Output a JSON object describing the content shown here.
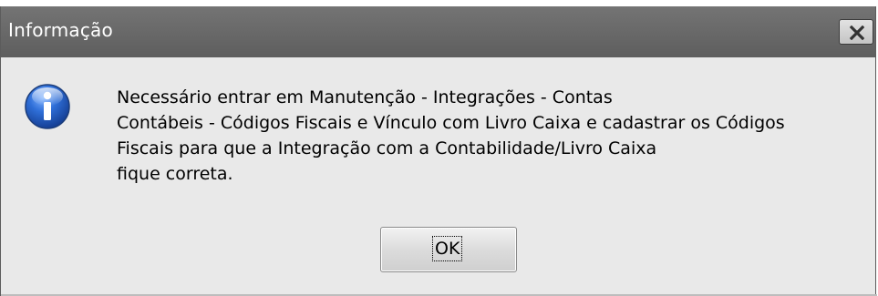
{
  "dialog": {
    "title": "Informação",
    "close_icon": "close-icon",
    "icon": "info-icon",
    "message_lines": [
      "Necessário entrar em Manutenção - Integrações - Contas",
      "Contábeis - Códigos Fiscais e Vínculo com Livro Caixa e cadastrar os Códigos",
      "Fiscais para que a Integração com a Contabilidade/Livro Caixa",
      "fique correta."
    ],
    "ok_label": "OK"
  },
  "colors": {
    "titlebar": "#6a6a6a",
    "title_text": "#ffffff",
    "background": "#e9e9e9",
    "icon_blue": "#2a63c8"
  }
}
